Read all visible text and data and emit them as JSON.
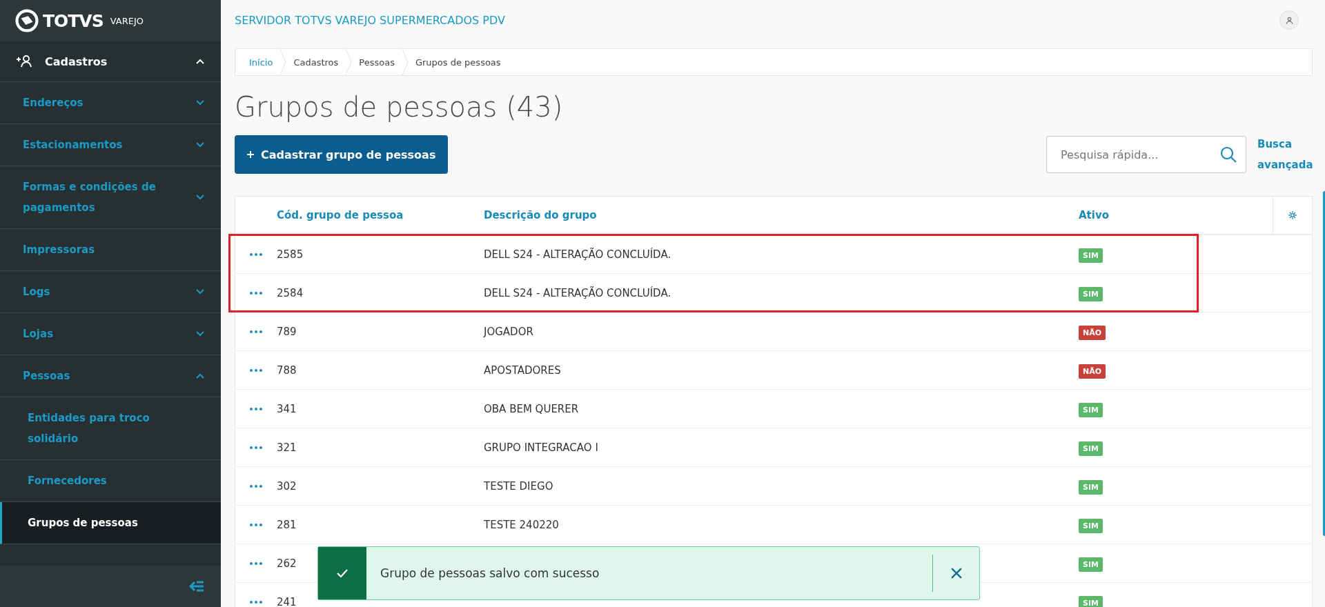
{
  "brand": {
    "name": "TOTVS",
    "sub": "VAREJO"
  },
  "sidebar": {
    "group": {
      "label": "Cadastros",
      "expanded": true
    },
    "items": [
      {
        "label": "Endereços",
        "expandable": true,
        "expanded": false,
        "selected": false
      },
      {
        "label": "Estacionamentos",
        "expandable": true,
        "expanded": false,
        "selected": false
      },
      {
        "label": "Formas e condições de pagamentos",
        "expandable": true,
        "expanded": false,
        "selected": false
      },
      {
        "label": "Impressoras",
        "expandable": false,
        "selected": false
      },
      {
        "label": "Logs",
        "expandable": true,
        "expanded": false,
        "selected": false
      },
      {
        "label": "Lojas",
        "expandable": true,
        "expanded": false,
        "selected": false
      },
      {
        "label": "Pessoas",
        "expandable": true,
        "expanded": true,
        "selected": false,
        "children": [
          {
            "label": "Entidades para troco solidário",
            "selected": false
          },
          {
            "label": "Fornecedores",
            "selected": false
          },
          {
            "label": "Grupos de pessoas",
            "selected": true
          }
        ]
      }
    ]
  },
  "header": {
    "title": "SERVIDOR TOTVS VAREJO SUPERMERCADOS PDV"
  },
  "breadcrumb": [
    {
      "label": "Início",
      "link": true
    },
    {
      "label": "Cadastros",
      "link": false
    },
    {
      "label": "Pessoas",
      "link": false
    },
    {
      "label": "Grupos de pessoas",
      "link": false
    }
  ],
  "page_title": "Grupos de pessoas (43)",
  "add_button": "Cadastrar grupo de pessoas",
  "search": {
    "placeholder": "Pesquisa rápida..."
  },
  "advanced_search": "Busca avançada",
  "table": {
    "columns": [
      "Cód. grupo de pessoa",
      "Descrição do grupo",
      "Ativo"
    ],
    "rows": [
      {
        "code": "2585",
        "description": "DELL S24 - ALTERAÇÃO CONCLUÍDA.",
        "active": "SIM",
        "active_state": true,
        "highlighted": true
      },
      {
        "code": "2584",
        "description": "DELL S24 - ALTERAÇÃO CONCLUÍDA.",
        "active": "SIM",
        "active_state": true,
        "highlighted": true
      },
      {
        "code": "789",
        "description": "JOGADOR",
        "active": "NÃO",
        "active_state": false,
        "highlighted": false
      },
      {
        "code": "788",
        "description": "APOSTADORES",
        "active": "NÃO",
        "active_state": false,
        "highlighted": false
      },
      {
        "code": "341",
        "description": "OBA BEM QUERER",
        "active": "SIM",
        "active_state": true,
        "highlighted": false
      },
      {
        "code": "321",
        "description": "GRUPO INTEGRACAO I",
        "active": "SIM",
        "active_state": true,
        "highlighted": false
      },
      {
        "code": "302",
        "description": "TESTE DIEGO",
        "active": "SIM",
        "active_state": true,
        "highlighted": false
      },
      {
        "code": "281",
        "description": "TESTE 240220",
        "active": "SIM",
        "active_state": true,
        "highlighted": false
      },
      {
        "code": "262",
        "active": "SIM",
        "active_state": true,
        "highlighted": false
      },
      {
        "code": "241",
        "active": "SIM",
        "active_state": true,
        "highlighted": false
      }
    ]
  },
  "toast": {
    "message": "Grupo de pessoas salvo com sucesso",
    "kind": "success"
  }
}
